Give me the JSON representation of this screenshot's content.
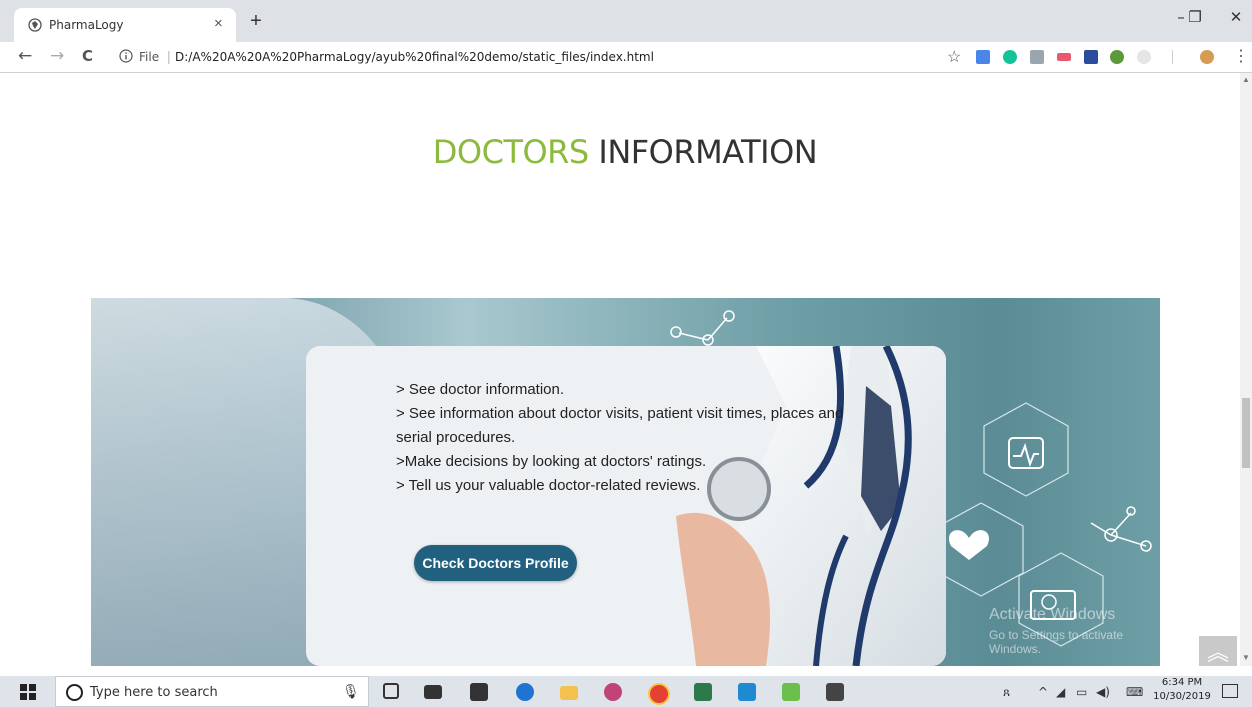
{
  "browser": {
    "tab_title": "PharmaLogy",
    "tab_close": "×",
    "new_tab": "+",
    "window_controls": {
      "minimize": "–",
      "maximize": "❐",
      "close": "✕"
    },
    "nav": {
      "back": "←",
      "forward": "→",
      "reload": "C"
    },
    "address": {
      "scheme_label": "File",
      "separator": "|",
      "url": "D:/A%20A%20A%20PharmaLogy/ayub%20final%20demo/static_files/index.html"
    },
    "bookmark_star": "☆",
    "menu": "⋮",
    "extensions": [
      "translate-icon",
      "grammarly-icon",
      "pdf-icon",
      "ext-icon",
      "ext-icon",
      "ext-icon",
      "ext-icon",
      "profile-avatar"
    ]
  },
  "page": {
    "heading_accent": "DOCTORS",
    "heading_rest": " INFORMATION",
    "card": {
      "bullets": [
        "> See doctor information.",
        "> See information about doctor visits, patient visit times, places and serial procedures.",
        ">Make decisions by looking at doctors' ratings.",
        "> Tell us your valuable doctor-related reviews."
      ],
      "button_label": "Check Doctors Profile"
    },
    "watermark": {
      "line1": "Activate Windows",
      "line2": "Go to Settings to activate Windows."
    },
    "back_to_top": "︽"
  },
  "taskbar": {
    "search_placeholder": "Type here to search",
    "time": "6:34 PM",
    "date": "10/30/2019"
  },
  "colors": {
    "accent_green": "#8cba3c",
    "button_blue": "#22607f"
  }
}
